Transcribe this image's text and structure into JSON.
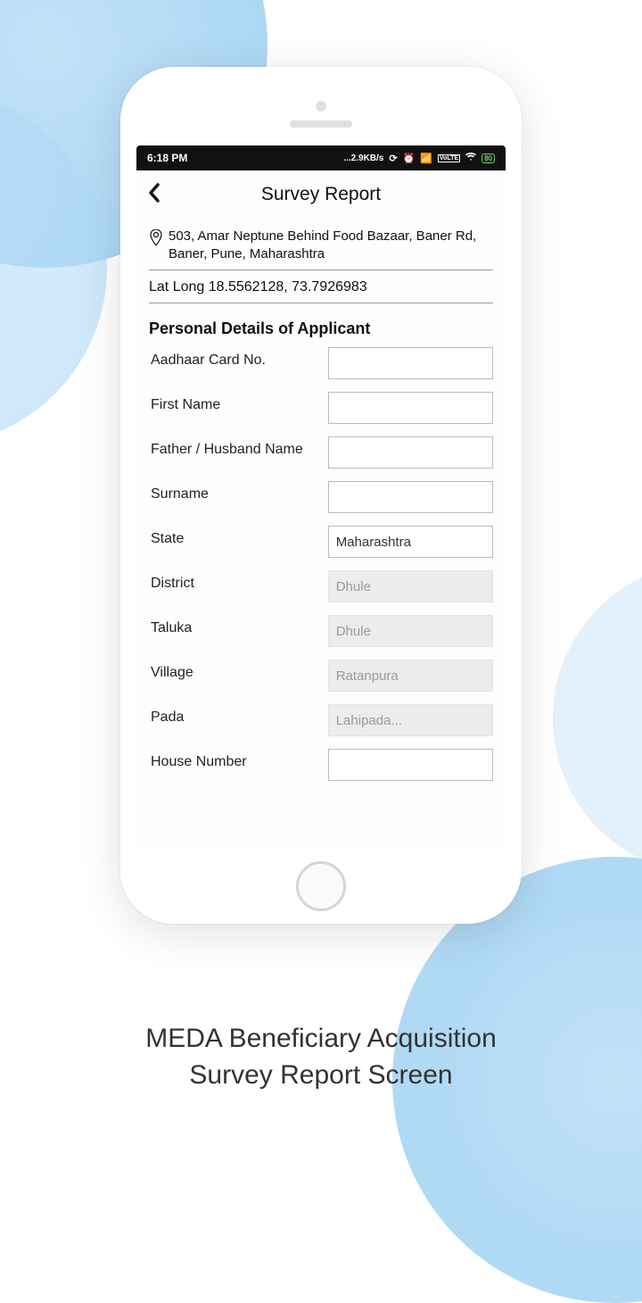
{
  "status": {
    "time": "6:18 PM",
    "speed": "...2.9KB/s",
    "battery": "80"
  },
  "header": {
    "title": "Survey Report"
  },
  "location": {
    "address": "503, Amar Neptune Behind Food Bazaar, Baner Rd, Baner, Pune, Maharashtra",
    "latlong": "Lat Long 18.5562128, 73.7926983"
  },
  "section": {
    "title": "Personal Details of Applicant"
  },
  "fields": {
    "aadhaar": {
      "label": "Aadhaar Card No.",
      "value": ""
    },
    "firstName": {
      "label": "First Name",
      "value": ""
    },
    "fatherHusband": {
      "label": "Father / Husband Name",
      "value": ""
    },
    "surname": {
      "label": "Surname",
      "value": ""
    },
    "state": {
      "label": "State",
      "value": "Maharashtra"
    },
    "district": {
      "label": "District",
      "value": "Dhule"
    },
    "taluka": {
      "label": "Taluka",
      "value": "Dhule"
    },
    "village": {
      "label": "Village",
      "value": "Ratanpura"
    },
    "pada": {
      "label": "Pada",
      "value": "Lahipada..."
    },
    "houseNumber": {
      "label": "House Number",
      "value": ""
    }
  },
  "caption": {
    "line1": "MEDA Beneficiary Acquisition",
    "line2": "Survey Report Screen"
  }
}
